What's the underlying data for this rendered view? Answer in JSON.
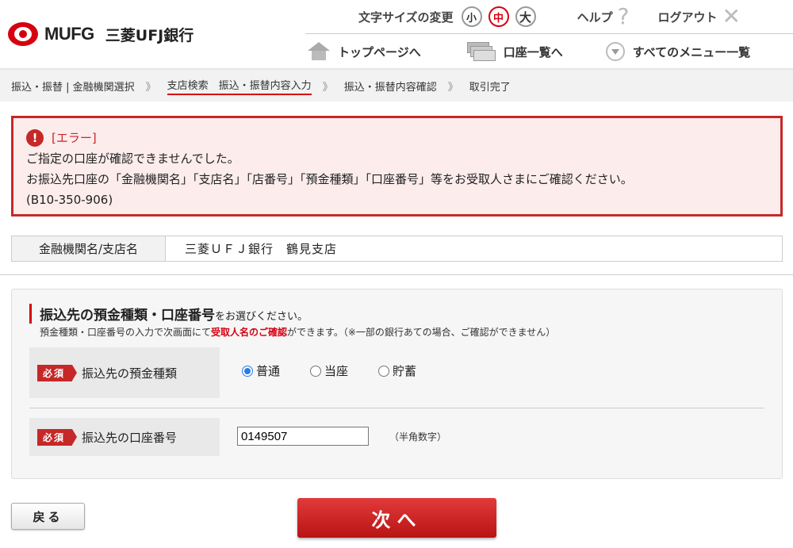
{
  "header": {
    "logo_text": "MUFG",
    "bank_name": "三菱UFJ銀行",
    "font_size_label": "文字サイズの変更",
    "font_sizes": [
      "小",
      "中",
      "大"
    ],
    "active_font_size": "中",
    "help_label": "ヘルプ",
    "logout_label": "ログアウト",
    "nav": {
      "top_page": "トップページへ",
      "account_list": "口座一覧へ",
      "all_menu": "すべてのメニュー一覧"
    }
  },
  "breadcrumb": [
    "振込・振替 | 金融機関選択",
    "支店検索　振込・振替内容入力",
    "振込・振替内容確認",
    "取引完了"
  ],
  "breadcrumb_separator": "》",
  "error": {
    "title": "[エラー]",
    "line1": "ご指定の口座が確認できませんでした。",
    "line2": "お振込先口座の「金融機関名」「支店名」「店番号」「預金種類」「口座番号」等をお受取人さまにご確認ください。",
    "code": "(B10-350-906)"
  },
  "bank": {
    "label": "金融機関名/支店名",
    "value": "三菱ＵＦＪ銀行　鶴見支店"
  },
  "form": {
    "title": "振込先の預金種類・口座番号",
    "title_suffix": "をお選びください。",
    "desc_prefix": "預金種類・口座番号の入力で次画面にて",
    "desc_highlight": "受取人名のご確認",
    "desc_suffix": "ができます。（※一部の銀行あての場合、ご確認ができません）",
    "required_badge": "必須",
    "deposit_type_label": "振込先の預金種類",
    "deposit_types": [
      "普通",
      "当座",
      "貯蓄"
    ],
    "selected_deposit_type": "普通",
    "account_number_label": "振込先の口座番号",
    "account_number_value": "0149507",
    "account_number_hint": "（半角数字）"
  },
  "buttons": {
    "back": "戻る",
    "next": "次へ"
  },
  "colors": {
    "brand_red": "#d7000f",
    "error_red": "#c62828",
    "error_bg": "#fcecec"
  }
}
